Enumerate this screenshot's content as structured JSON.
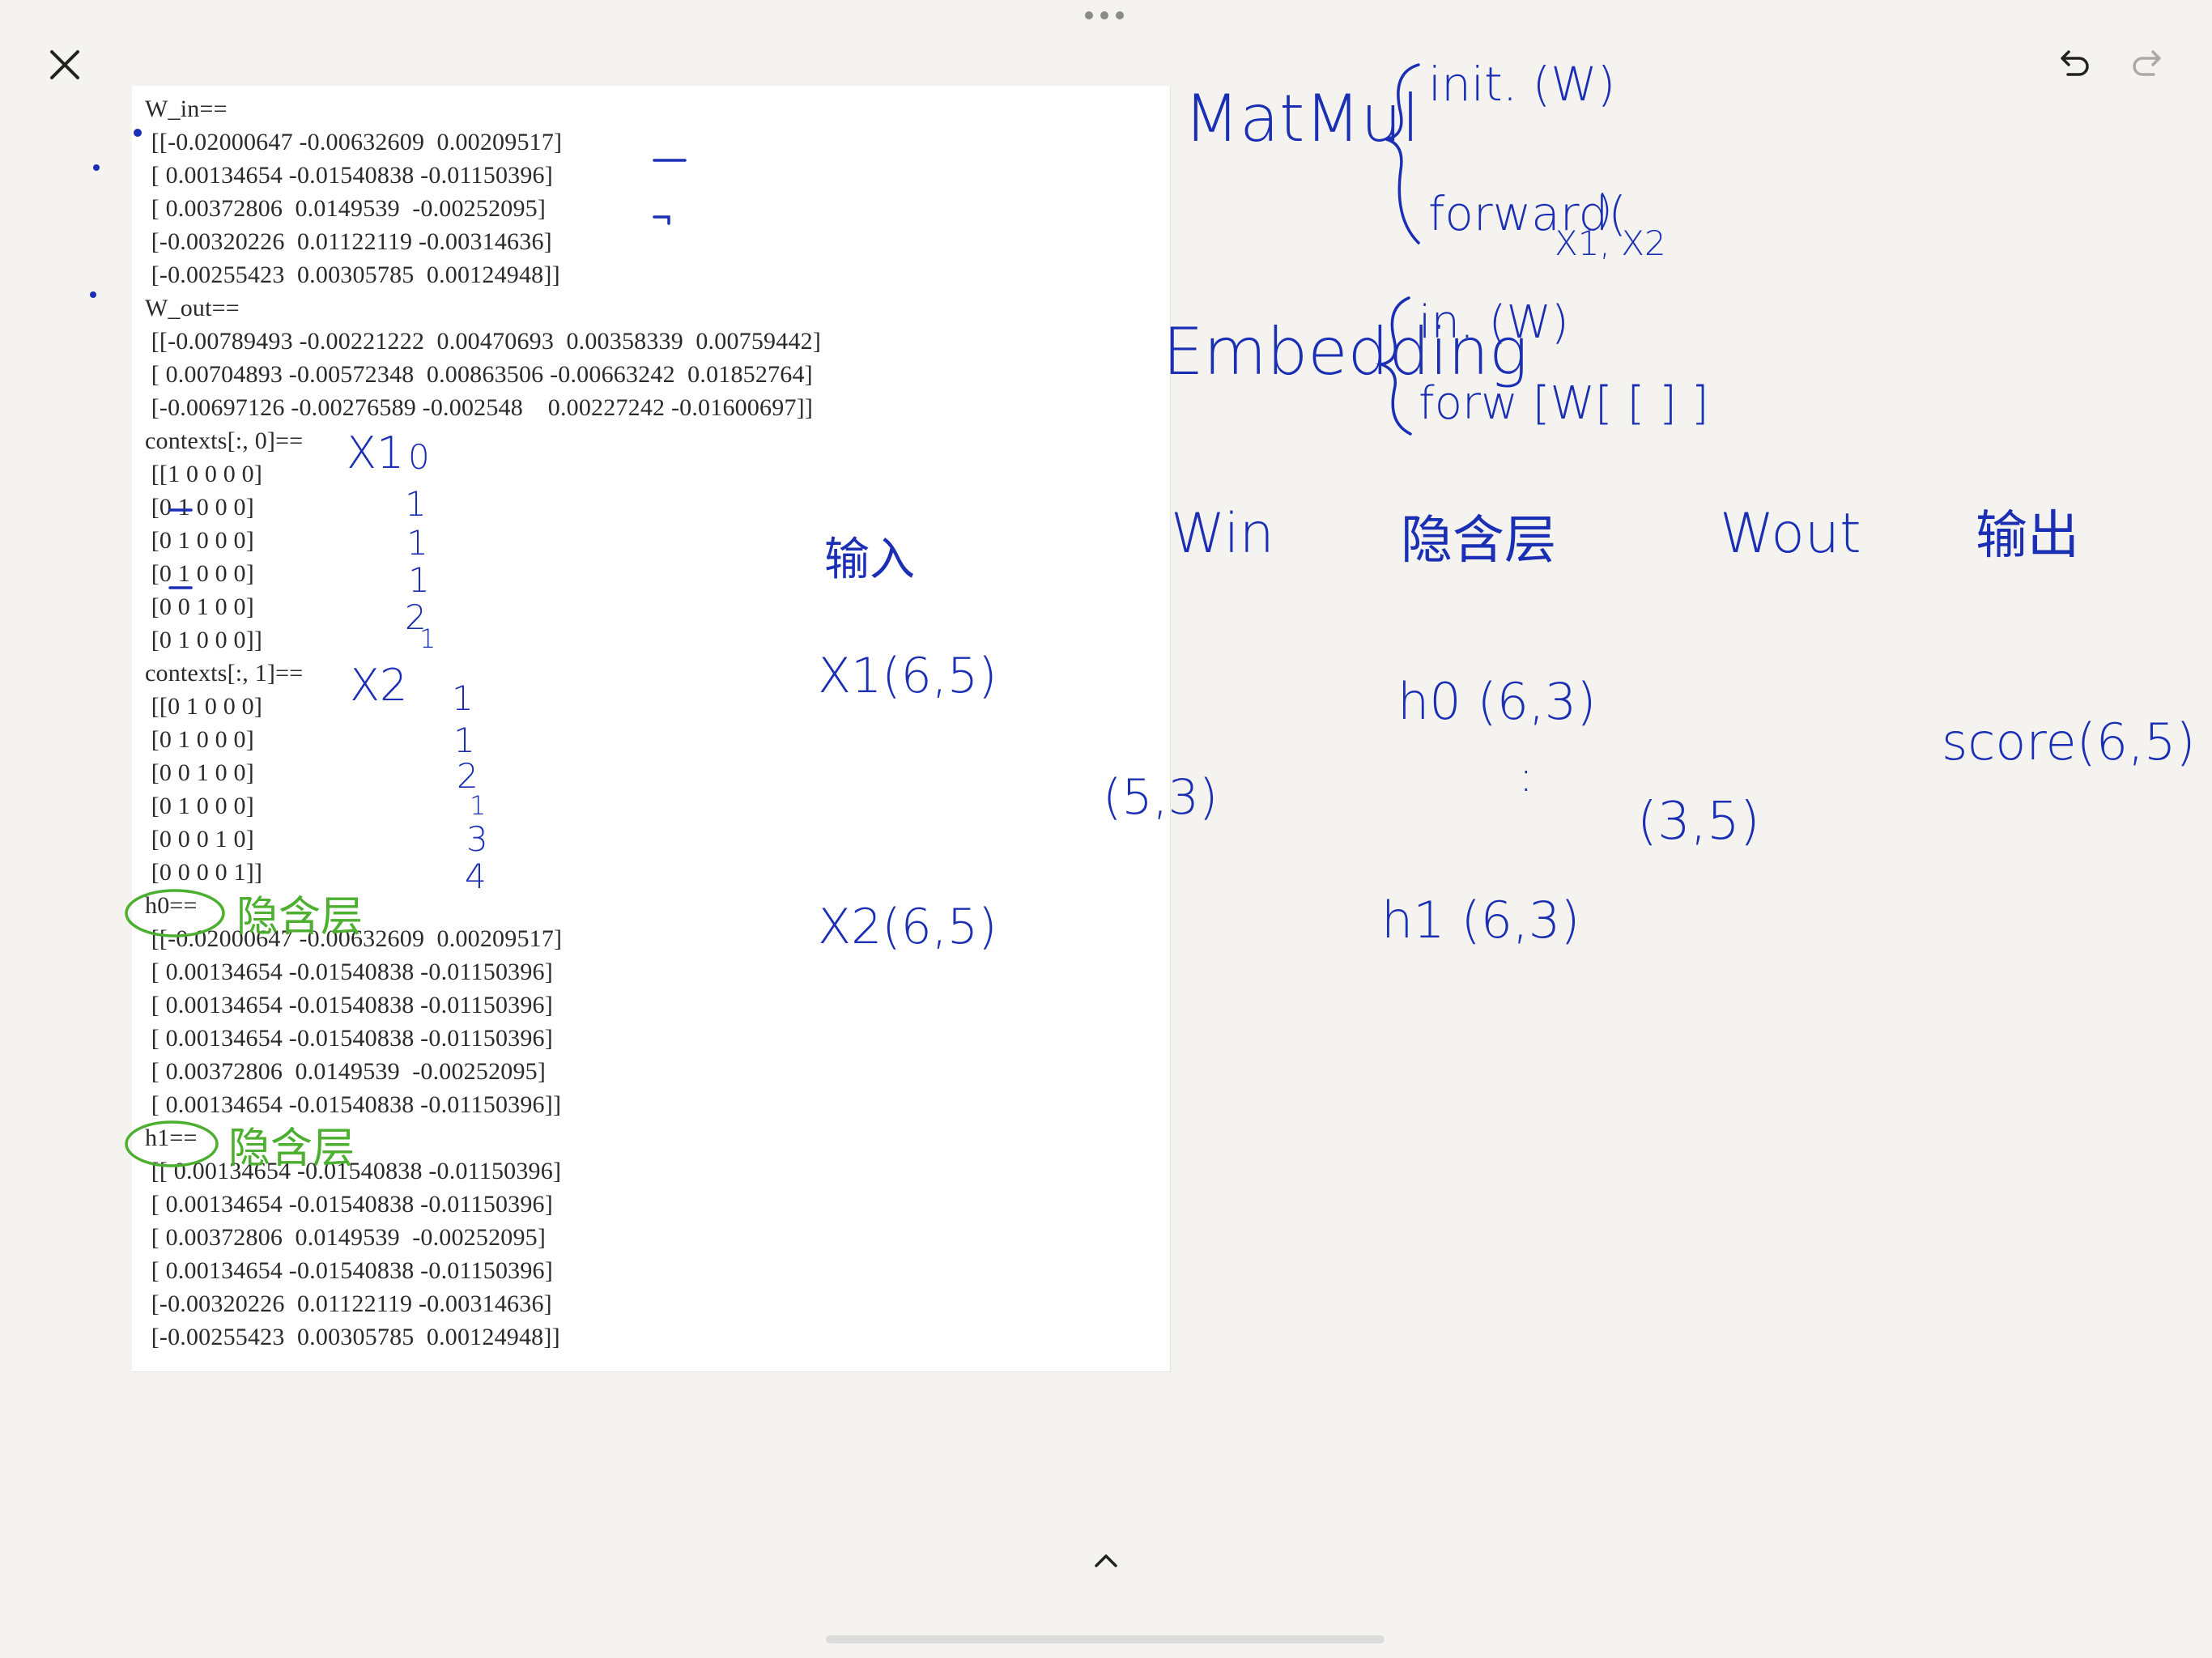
{
  "toolbar": {
    "close_icon": "close-icon",
    "undo_icon": "undo-icon",
    "redo_icon": "redo-icon",
    "more_icon": "more-dots-icon",
    "expand_icon": "chevron-up-icon"
  },
  "colors": {
    "ink_blue": "#1b2fb5",
    "ink_green": "#4caf2f",
    "canvas": "#f4f3ef"
  },
  "output": {
    "lines": [
      "W_in==",
      " [[-0.02000647 -0.00632609  0.00209517]",
      " [ 0.00134654 -0.01540838 -0.01150396]",
      " [ 0.00372806  0.0149539  -0.00252095]",
      " [-0.00320226  0.01122119 -0.00314636]",
      " [-0.00255423  0.00305785  0.00124948]]",
      "W_out==",
      " [[-0.00789493 -0.00221222  0.00470693  0.00358339  0.00759442]",
      " [ 0.00704893 -0.00572348  0.00863506 -0.00663242  0.01852764]",
      " [-0.00697126 -0.00276589 -0.002548    0.00227242 -0.01600697]]",
      "contexts[:, 0]==",
      " [[1 0 0 0 0]",
      " [0 1 0 0 0]",
      " [0 1 0 0 0]",
      " [0 1 0 0 0]",
      " [0 0 1 0 0]",
      " [0 1 0 0 0]]",
      "contexts[:, 1]==",
      " [[0 1 0 0 0]",
      " [0 1 0 0 0]",
      " [0 0 1 0 0]",
      " [0 1 0 0 0]",
      " [0 0 0 1 0]",
      " [0 0 0 0 1]]",
      "h0==",
      " [[-0.02000647 -0.00632609  0.00209517]",
      " [ 0.00134654 -0.01540838 -0.01150396]",
      " [ 0.00134654 -0.01540838 -0.01150396]",
      " [ 0.00134654 -0.01540838 -0.01150396]",
      " [ 0.00372806  0.0149539  -0.00252095]",
      " [ 0.00134654 -0.01540838 -0.01150396]]",
      "h1==",
      " [[ 0.00134654 -0.01540838 -0.01150396]",
      " [ 0.00134654 -0.01540838 -0.01150396]",
      " [ 0.00372806  0.0149539  -0.00252095]",
      " [ 0.00134654 -0.01540838 -0.01150396]",
      " [-0.00320226  0.01122119 -0.00314636]",
      " [-0.00255423  0.00305785  0.00124948]]"
    ]
  },
  "notes": {
    "x1_label": "X1",
    "x2_label": "X2",
    "ctx0_indices": [
      "0",
      "1",
      "1",
      "1",
      "2",
      "1"
    ],
    "ctx1_indices": [
      "1",
      "1",
      "2",
      "1",
      "3",
      "4"
    ],
    "h0_note": "隐含层",
    "h1_note": "隐含层",
    "input_label": "输入",
    "x1_shape": "X1(6,5)",
    "x2_shape": "X2(6,5)",
    "matmul_title": "MatMul",
    "matmul_init": "init. (W)",
    "matmul_forward": "forward(",
    "matmul_forward_close": ")",
    "matmul_args": "X1, X2",
    "embedding_title": "Embedding",
    "embedding_init": "in. (W)",
    "embedding_forward": "forw [W[ [ ] ]",
    "col_win": "Win",
    "col_hidden": "隐含层",
    "col_wout": "Wout",
    "col_output": "输出",
    "win_shape": "(5,3)",
    "h0_shape": "h0 (6,3)",
    "ellipsis": ":",
    "h1_shape": "h1 (6,3)",
    "wout_shape": "(3,5)",
    "score_shape": "score(6,5)"
  }
}
